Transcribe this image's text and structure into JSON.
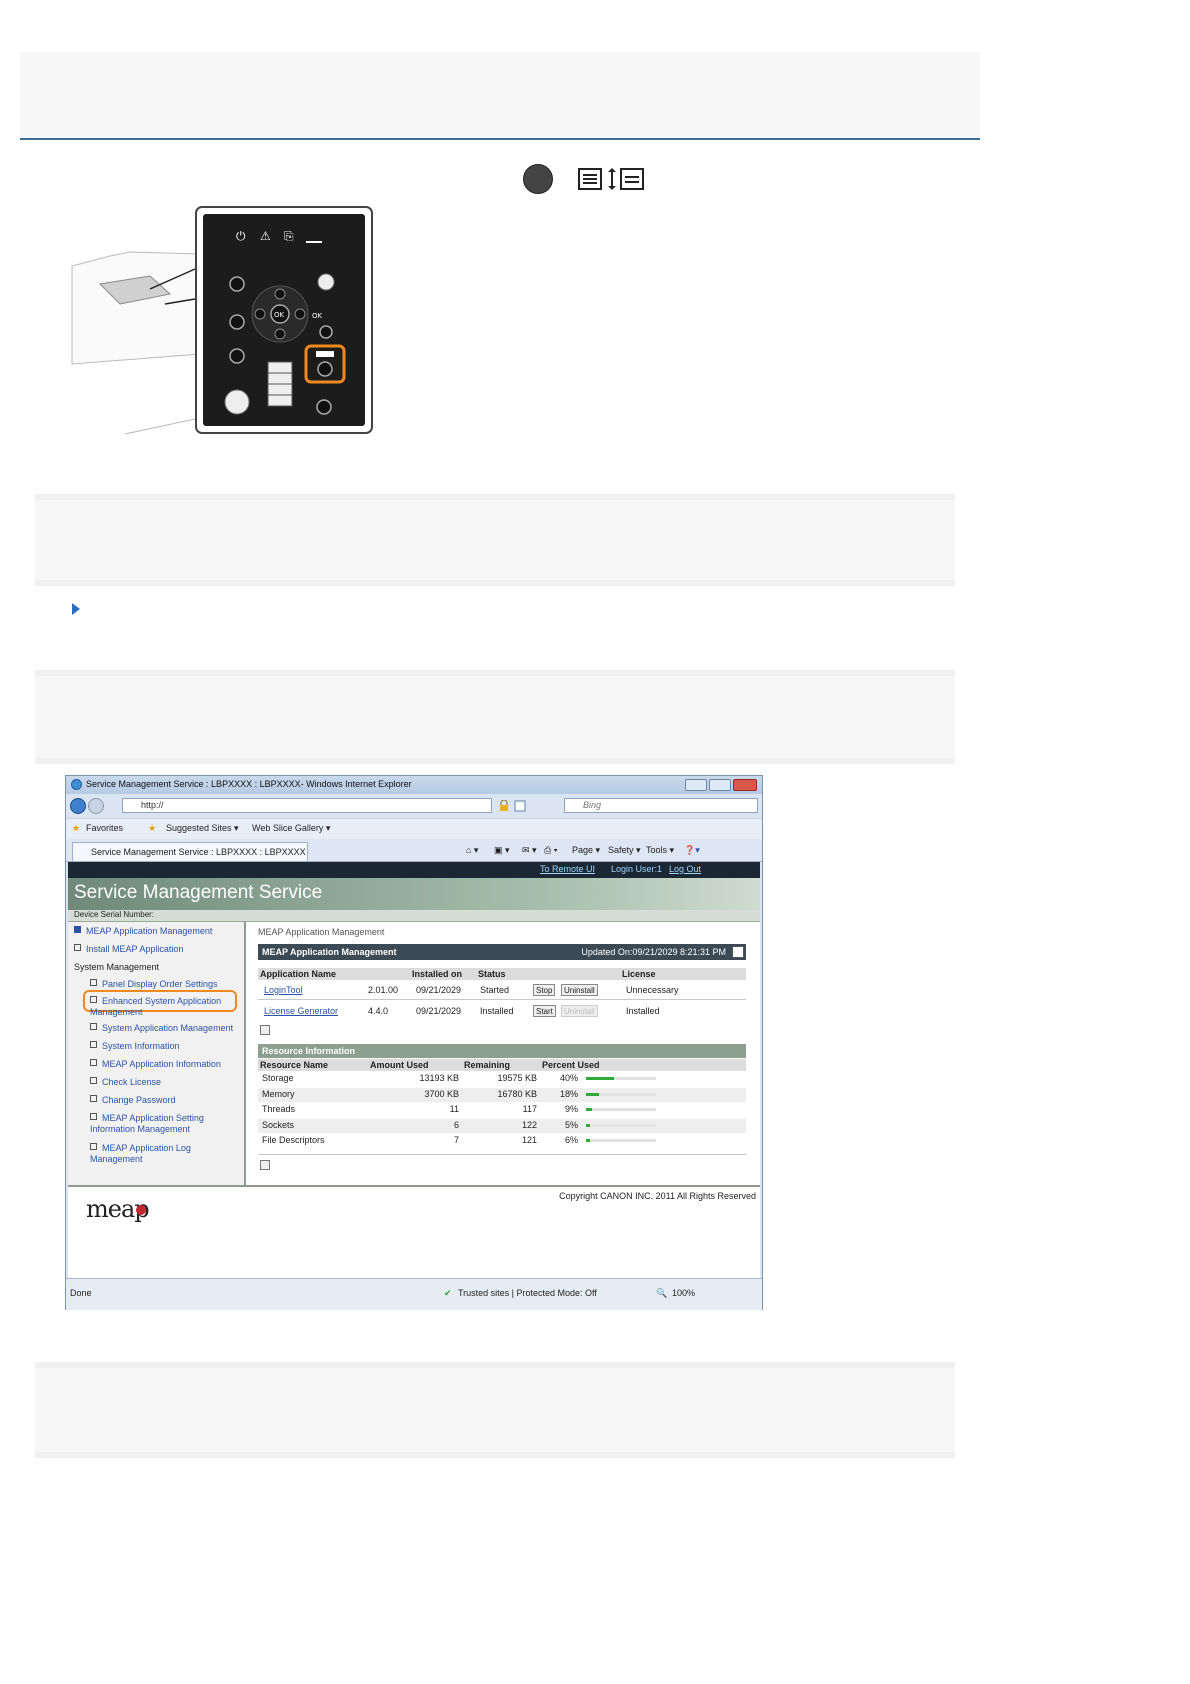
{
  "step_icons": {
    "circle_key": "",
    "display_keys": ""
  },
  "illustration": {
    "labels": [
      "OK"
    ]
  },
  "browser": {
    "window_title": "Service Management Service : LBPXXXX : LBPXXXX- Windows Internet Explorer",
    "address": "http://",
    "search_placeholder": "Bing",
    "favorites": "Favorites",
    "suggested_sites": "Suggested Sites ▾",
    "web_slice": "Web Slice Gallery ▾",
    "tab_title": "Service Management Service : LBPXXXX : LBPXXXX",
    "tools": {
      "page": "Page ▾",
      "safety": "Safety ▾",
      "tools": "Tools ▾"
    },
    "top_links": {
      "remote_ui": "To Remote UI",
      "login_user": "Login User:1",
      "logout": "Log Out"
    },
    "app_title": "Service Management Service",
    "serial_label": "Device Serial Number:",
    "sidebar": {
      "meap_mgmt": "MEAP Application Management",
      "install": "Install MEAP Application",
      "system_mgmt": "System Management",
      "items": [
        "Panel Display Order Settings",
        "Enhanced System Application Management",
        "System Application Management",
        "System Information",
        "MEAP Application Information",
        "Check License",
        "Change Password",
        "MEAP Application Setting Information Management",
        "MEAP Application Log Management"
      ]
    },
    "main": {
      "breadcrumb": "MEAP Application Management",
      "section_title": "MEAP Application Management",
      "updated": "Updated On:09/21/2029 8:21:31 PM",
      "app_headers": {
        "name": "Application Name",
        "installed": "Installed on",
        "status": "Status",
        "license": "License"
      },
      "apps": [
        {
          "name": "LoginTool",
          "version": "2.01.00",
          "date": "09/21/2029",
          "status": "Started",
          "btn1": "Stop",
          "btn2": "Uninstall",
          "license": "Unnecessary"
        },
        {
          "name": "License Generator",
          "version": "4.4.0",
          "date": "09/21/2029",
          "status": "Installed",
          "btn1": "Start",
          "btn2": "Uninstall",
          "license": "Installed"
        }
      ],
      "resource_title": "Resource Information",
      "res_headers": {
        "name": "Resource Name",
        "amount": "Amount Used",
        "remaining": "Remaining",
        "percent": "Percent Used"
      },
      "resources": [
        {
          "name": "Storage",
          "amount": "13193 KB",
          "remaining": "19575 KB",
          "percent": "40%",
          "fraction": 0.4
        },
        {
          "name": "Memory",
          "amount": "3700 KB",
          "remaining": "16780 KB",
          "percent": "18%",
          "fraction": 0.18
        },
        {
          "name": "Threads",
          "amount": "11",
          "remaining": "117",
          "percent": "9%",
          "fraction": 0.09
        },
        {
          "name": "Sockets",
          "amount": "6",
          "remaining": "122",
          "percent": "5%",
          "fraction": 0.05
        },
        {
          "name": "File Descriptors",
          "amount": "7",
          "remaining": "121",
          "percent": "6%",
          "fraction": 0.06
        }
      ]
    },
    "footer": {
      "copyright": "Copyright CANON INC. 2011 All Rights Reserved",
      "logo": "meap"
    },
    "status": {
      "done": "Done",
      "zone": "Trusted sites | Protected Mode: Off",
      "zoom": "100%"
    }
  }
}
